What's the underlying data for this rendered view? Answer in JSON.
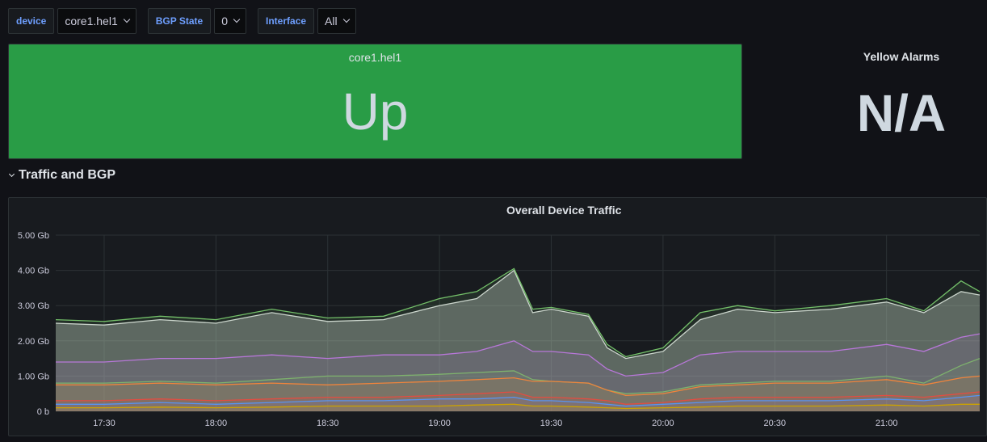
{
  "variables": [
    {
      "label": "device",
      "value": "core1.hel1"
    },
    {
      "label": "BGP State",
      "value": "0"
    },
    {
      "label": "Interface",
      "value": "All"
    }
  ],
  "status_panel": {
    "title": "core1.hel1",
    "value": "Up",
    "color": "#299c46"
  },
  "alarm_panel": {
    "title": "Yellow Alarms",
    "value": "N/A"
  },
  "row": {
    "title": "Traffic and BGP"
  },
  "graph": {
    "title": "Overall Device Traffic"
  },
  "chart_data": {
    "type": "area",
    "title": "Overall Device Traffic",
    "xlabel": "",
    "ylabel": "",
    "y_ticks": [
      "0 b",
      "1.00 Gb",
      "2.00 Gb",
      "3.00 Gb",
      "4.00 Gb",
      "5.00 Gb"
    ],
    "x_ticks": [
      "17:30",
      "18:00",
      "18:30",
      "19:00",
      "19:30",
      "20:00",
      "20:30",
      "21:00"
    ],
    "ylim": [
      0,
      5
    ],
    "grid": true,
    "series": [
      {
        "color": "#d8d9da",
        "x": [
          "17:17",
          "17:30",
          "17:45",
          "18:00",
          "18:15",
          "18:30",
          "18:45",
          "19:00",
          "19:10",
          "19:20",
          "19:25",
          "19:30",
          "19:40",
          "19:45",
          "19:50",
          "20:00",
          "20:10",
          "20:20",
          "20:30",
          "20:45",
          "21:00",
          "21:10",
          "21:20",
          "21:25"
        ],
        "values": [
          2.5,
          2.45,
          2.6,
          2.5,
          2.8,
          2.55,
          2.6,
          3.0,
          3.2,
          4.0,
          2.8,
          2.9,
          2.7,
          1.8,
          1.5,
          1.7,
          2.6,
          2.9,
          2.8,
          2.9,
          3.1,
          2.8,
          3.4,
          3.3
        ]
      },
      {
        "color": "#73bf69",
        "x": [
          "17:17",
          "17:30",
          "17:45",
          "18:00",
          "18:15",
          "18:30",
          "18:45",
          "19:00",
          "19:10",
          "19:20",
          "19:25",
          "19:30",
          "19:40",
          "19:45",
          "19:50",
          "20:00",
          "20:10",
          "20:20",
          "20:30",
          "20:45",
          "21:00",
          "21:10",
          "21:20",
          "21:25"
        ],
        "values": [
          2.6,
          2.55,
          2.7,
          2.6,
          2.9,
          2.65,
          2.7,
          3.2,
          3.4,
          4.05,
          2.9,
          2.95,
          2.75,
          1.9,
          1.55,
          1.8,
          2.8,
          3.0,
          2.85,
          3.0,
          3.2,
          2.85,
          3.7,
          3.4
        ]
      },
      {
        "color": "#b877d9",
        "x": [
          "17:17",
          "17:30",
          "17:45",
          "18:00",
          "18:15",
          "18:30",
          "18:45",
          "19:00",
          "19:10",
          "19:20",
          "19:25",
          "19:30",
          "19:40",
          "19:45",
          "19:50",
          "20:00",
          "20:10",
          "20:20",
          "20:30",
          "20:45",
          "21:00",
          "21:10",
          "21:20",
          "21:25"
        ],
        "values": [
          1.4,
          1.4,
          1.5,
          1.5,
          1.6,
          1.5,
          1.6,
          1.6,
          1.7,
          2.0,
          1.7,
          1.7,
          1.6,
          1.2,
          1.0,
          1.1,
          1.6,
          1.7,
          1.7,
          1.7,
          1.9,
          1.7,
          2.1,
          2.2
        ]
      },
      {
        "color": "#7eb26d",
        "x": [
          "17:17",
          "17:30",
          "17:45",
          "18:00",
          "18:15",
          "18:30",
          "18:45",
          "19:00",
          "19:10",
          "19:20",
          "19:25",
          "19:30",
          "19:40",
          "19:45",
          "19:50",
          "20:00",
          "20:10",
          "20:20",
          "20:30",
          "20:45",
          "21:00",
          "21:10",
          "21:20",
          "21:25"
        ],
        "values": [
          0.8,
          0.8,
          0.85,
          0.8,
          0.9,
          1.0,
          1.0,
          1.05,
          1.1,
          1.15,
          0.9,
          0.85,
          0.8,
          0.6,
          0.5,
          0.55,
          0.75,
          0.8,
          0.85,
          0.85,
          1.0,
          0.8,
          1.3,
          1.5
        ]
      },
      {
        "color": "#ef843c",
        "x": [
          "17:17",
          "17:30",
          "17:45",
          "18:00",
          "18:15",
          "18:30",
          "18:45",
          "19:00",
          "19:10",
          "19:20",
          "19:25",
          "19:30",
          "19:40",
          "19:45",
          "19:50",
          "20:00",
          "20:10",
          "20:20",
          "20:30",
          "20:45",
          "21:00",
          "21:10",
          "21:20",
          "21:25"
        ],
        "values": [
          0.75,
          0.75,
          0.8,
          0.75,
          0.8,
          0.75,
          0.8,
          0.85,
          0.9,
          0.95,
          0.85,
          0.85,
          0.8,
          0.6,
          0.45,
          0.5,
          0.7,
          0.75,
          0.8,
          0.8,
          0.9,
          0.75,
          0.95,
          1.0
        ]
      },
      {
        "color": "#e24d42",
        "x": [
          "17:17",
          "17:30",
          "17:45",
          "18:00",
          "18:15",
          "18:30",
          "18:45",
          "19:00",
          "19:10",
          "19:20",
          "19:25",
          "19:30",
          "19:40",
          "19:45",
          "19:50",
          "20:00",
          "20:10",
          "20:20",
          "20:30",
          "20:45",
          "21:00",
          "21:10",
          "21:20",
          "21:25"
        ],
        "values": [
          0.3,
          0.3,
          0.35,
          0.3,
          0.35,
          0.4,
          0.4,
          0.45,
          0.5,
          0.55,
          0.4,
          0.4,
          0.35,
          0.3,
          0.2,
          0.25,
          0.35,
          0.4,
          0.4,
          0.4,
          0.45,
          0.4,
          0.5,
          0.55
        ]
      },
      {
        "color": "#5794f2",
        "x": [
          "17:17",
          "17:30",
          "17:45",
          "18:00",
          "18:15",
          "18:30",
          "18:45",
          "19:00",
          "19:10",
          "19:20",
          "19:25",
          "19:30",
          "19:40",
          "19:45",
          "19:50",
          "20:00",
          "20:10",
          "20:20",
          "20:30",
          "20:45",
          "21:00",
          "21:10",
          "21:20",
          "21:25"
        ],
        "values": [
          0.2,
          0.2,
          0.25,
          0.2,
          0.25,
          0.3,
          0.3,
          0.35,
          0.35,
          0.4,
          0.3,
          0.3,
          0.25,
          0.2,
          0.15,
          0.2,
          0.25,
          0.3,
          0.3,
          0.3,
          0.35,
          0.3,
          0.4,
          0.45
        ]
      },
      {
        "color": "#cca300",
        "x": [
          "17:17",
          "17:30",
          "17:45",
          "18:00",
          "18:15",
          "18:30",
          "18:45",
          "19:00",
          "19:10",
          "19:20",
          "19:25",
          "19:30",
          "19:40",
          "19:45",
          "19:50",
          "20:00",
          "20:10",
          "20:20",
          "20:30",
          "20:45",
          "21:00",
          "21:10",
          "21:20",
          "21:25"
        ],
        "values": [
          0.1,
          0.1,
          0.12,
          0.1,
          0.12,
          0.15,
          0.15,
          0.15,
          0.18,
          0.2,
          0.15,
          0.15,
          0.12,
          0.1,
          0.08,
          0.1,
          0.12,
          0.15,
          0.15,
          0.15,
          0.18,
          0.15,
          0.2,
          0.2
        ]
      }
    ]
  }
}
